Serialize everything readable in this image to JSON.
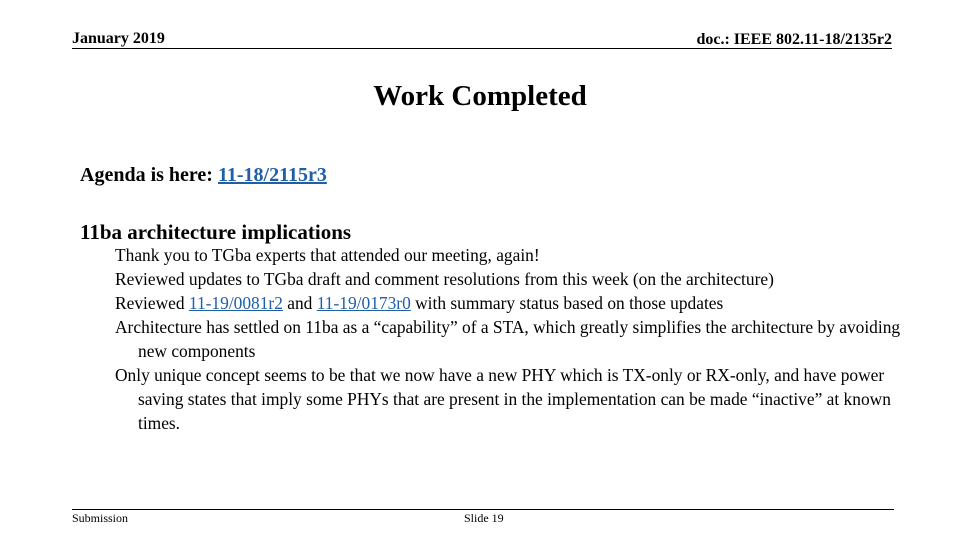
{
  "header": {
    "date": "January 2019",
    "doc_id": "doc.: IEEE 802.11-18/2135r2"
  },
  "title": "Work Completed",
  "agenda": {
    "label": "Agenda is here: ",
    "link_text": "11-18/2115r3"
  },
  "section": {
    "heading": "11ba architecture implications",
    "bullets": [
      {
        "text": "Thank you to TGba experts that attended our meeting, again!"
      },
      {
        "text": "Reviewed updates to TGba draft and comment resolutions from this week (on the architecture)"
      },
      {
        "prefix": "Reviewed ",
        "link1": "11-19/0081r2",
        "middle": " and ",
        "link2": "11-19/0173r0",
        "suffix": " with summary status based on those updates"
      },
      {
        "text": "Architecture has settled on 11ba as a “capability” of a STA, which greatly simplifies the architecture by avoiding new components"
      },
      {
        "text": "Only unique concept seems to be that we now have a new PHY which is TX-only or RX-only, and have power saving states that imply some PHYs that are present in the implementation can be made “inactive” at known times."
      }
    ]
  },
  "footer": {
    "left": "Submission",
    "center": "Slide 19"
  },
  "colors": {
    "link": "#1f5fa8",
    "text": "#000000",
    "background": "#ffffff"
  }
}
